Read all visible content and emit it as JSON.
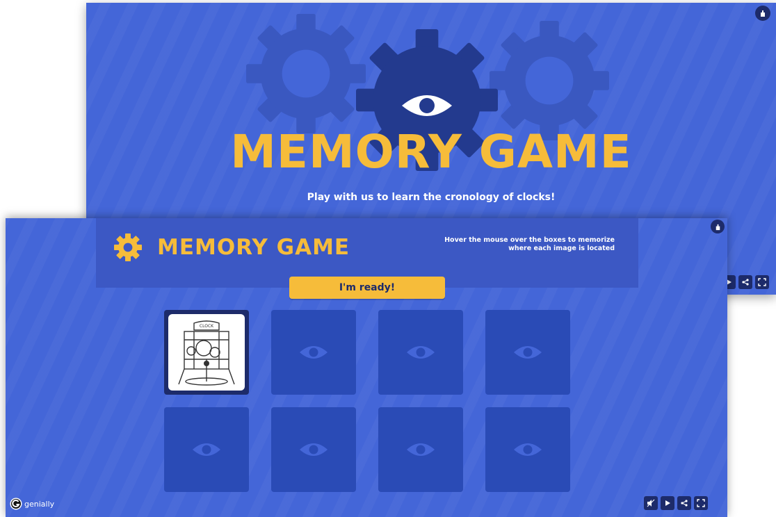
{
  "back_slide": {
    "title": "MEMORY GAME",
    "subtitle": "Play with us to learn the cronology of clocks!"
  },
  "front_slide": {
    "title": "MEMORY GAME",
    "instructions": "Hover the mouse over the boxes to memorize where each image is located",
    "ready_button": "I'm ready!",
    "cards": [
      {
        "state": "revealed",
        "content": "clock-illustration"
      },
      {
        "state": "hidden",
        "content": "eye-icon"
      },
      {
        "state": "hidden",
        "content": "eye-icon"
      },
      {
        "state": "hidden",
        "content": "eye-icon"
      },
      {
        "state": "hidden",
        "content": "eye-icon"
      },
      {
        "state": "hidden",
        "content": "eye-icon"
      },
      {
        "state": "hidden",
        "content": "eye-icon"
      },
      {
        "state": "hidden",
        "content": "eye-icon"
      }
    ]
  },
  "branding": {
    "logo_text": "genially"
  },
  "controls": [
    "mute-icon",
    "play-icon",
    "share-icon",
    "fullscreen-icon"
  ],
  "colors": {
    "background": "#4466d8",
    "dark_blue": "#1d2b6a",
    "card_blue": "#2a4bb6",
    "accent_yellow": "#f6bc3a"
  }
}
